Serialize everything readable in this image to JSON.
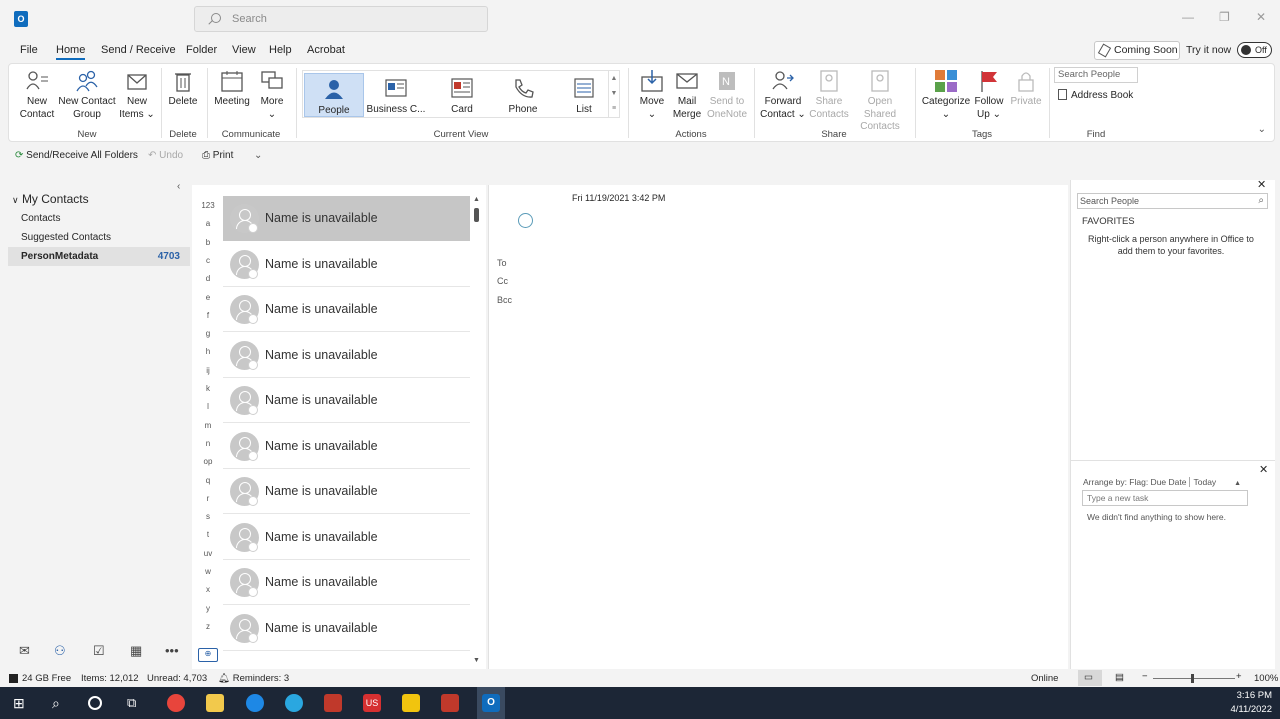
{
  "title_bar": {
    "app_icon": "O",
    "search_placeholder": "Search"
  },
  "menu": {
    "items": [
      "File",
      "Home",
      "Send / Receive",
      "Folder",
      "View",
      "Help",
      "Acrobat"
    ],
    "active": "Home",
    "coming_soon": "Coming Soon",
    "try_it_now": "Try it now",
    "toggle_state": "Off"
  },
  "ribbon": {
    "new": {
      "new_contact": "New Contact",
      "new_contact_group": "New Contact Group",
      "new_items": "New Items",
      "label": "New"
    },
    "delete": {
      "delete": "Delete",
      "label": "Delete"
    },
    "communicate": {
      "meeting": "Meeting",
      "more": "More",
      "label": "Communicate"
    },
    "current_view": {
      "items": [
        "People",
        "Business C...",
        "Card",
        "Phone",
        "List"
      ],
      "selected": "People",
      "label": "Current View"
    },
    "actions": {
      "move": "Move",
      "mail_merge": "Mail Merge",
      "send_to_onenote": "Send to OneNote",
      "label": "Actions"
    },
    "share": {
      "forward_contact": "Forward Contact",
      "share_contacts": "Share Contacts",
      "open_shared_contacts": "Open Shared Contacts",
      "label": "Share"
    },
    "tags": {
      "categorize": "Categorize",
      "follow_up": "Follow Up",
      "private": "Private",
      "label": "Tags"
    },
    "find": {
      "search_people_placeholder": "Search People",
      "address_book": "Address Book",
      "label": "Find"
    }
  },
  "quick_access": {
    "send_receive_all": "Send/Receive All Folders",
    "undo": "Undo",
    "print": "Print"
  },
  "folders": {
    "header": "My Contacts",
    "items": [
      {
        "name": "Contacts",
        "count": ""
      },
      {
        "name": "Suggested Contacts",
        "count": ""
      },
      {
        "name": "PersonMetadata",
        "count": "4703"
      }
    ]
  },
  "alphabet": [
    "123",
    "a",
    "b",
    "c",
    "d",
    "e",
    "f",
    "g",
    "h",
    "ij",
    "k",
    "l",
    "m",
    "n",
    "op",
    "q",
    "r",
    "s",
    "t",
    "uv",
    "w",
    "x",
    "y",
    "z"
  ],
  "contacts": [
    "Name is unavailable",
    "Name is unavailable",
    "Name is unavailable",
    "Name is unavailable",
    "Name is unavailable",
    "Name is unavailable",
    "Name is unavailable",
    "Name is unavailable",
    "Name is unavailable",
    "Name is unavailable"
  ],
  "reading_pane": {
    "date": "Fri 11/19/2021 3:42 PM",
    "to": "To",
    "cc": "Cc",
    "bcc": "Bcc"
  },
  "people_pane": {
    "search_placeholder": "Search People",
    "favorites_header": "FAVORITES",
    "favorites_hint": "Right-click a person anywhere in Office to add them to your favorites.",
    "arrange_by": "Arrange by: Flag: Due Date",
    "arrange_today": "Today",
    "new_task_placeholder": "Type a new task",
    "empty_tasks": "We didn't find anything to show here."
  },
  "status_bar": {
    "free_space": "24 GB Free",
    "items": "Items: 12,012",
    "unread": "Unread: 4,703",
    "reminders": "Reminders: 3",
    "online": "Online",
    "zoom": "100%"
  },
  "taskbar": {
    "time": "3:16 PM",
    "date": "4/11/2022"
  },
  "colors": {
    "accent": "#0f6cbd",
    "selection": "#c6c6c6",
    "taskbar": "#1c2636"
  }
}
